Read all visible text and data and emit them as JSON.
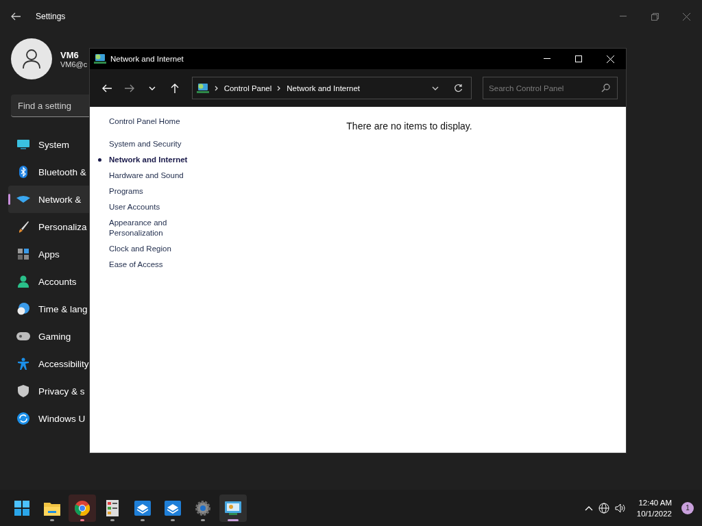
{
  "settings": {
    "title": "Settings",
    "profile": {
      "name": "VM6",
      "email": "VM6@c"
    },
    "search": {
      "placeholder": "Find a setting"
    },
    "nav": [
      {
        "label": "System",
        "selected": false
      },
      {
        "label": "Bluetooth &",
        "selected": false
      },
      {
        "label": "Network &",
        "selected": true
      },
      {
        "label": "Personaliza",
        "selected": false
      },
      {
        "label": "Apps",
        "selected": false
      },
      {
        "label": "Accounts",
        "selected": false
      },
      {
        "label": "Time & lang",
        "selected": false
      },
      {
        "label": "Gaming",
        "selected": false
      },
      {
        "label": "Accessibility",
        "selected": false
      },
      {
        "label": "Privacy & s",
        "selected": false
      },
      {
        "label": "Windows U",
        "selected": false
      }
    ]
  },
  "control_panel": {
    "title": "Network and Internet",
    "address": [
      "Control Panel",
      "Network and Internet"
    ],
    "search": {
      "placeholder": "Search Control Panel"
    },
    "home_link": "Control Panel Home",
    "categories": [
      {
        "label": "System and Security",
        "selected": false
      },
      {
        "label": "Network and Internet",
        "selected": true
      },
      {
        "label": "Hardware and Sound",
        "selected": false
      },
      {
        "label": "Programs",
        "selected": false
      },
      {
        "label": "User Accounts",
        "selected": false
      },
      {
        "label": "Appearance and Personalization",
        "selected": false
      },
      {
        "label": "Clock and Region",
        "selected": false
      },
      {
        "label": "Ease of Access",
        "selected": false
      }
    ],
    "message": "There are no items to display."
  },
  "taskbar": {
    "apps": [
      {
        "running": false,
        "attention": false,
        "focused": false
      },
      {
        "running": true,
        "attention": false,
        "focused": false
      },
      {
        "running": true,
        "attention": true,
        "focused": false
      },
      {
        "running": true,
        "attention": false,
        "focused": false
      },
      {
        "running": true,
        "attention": false,
        "focused": false
      },
      {
        "running": true,
        "attention": false,
        "focused": false
      },
      {
        "running": true,
        "attention": false,
        "focused": false
      },
      {
        "running": true,
        "attention": false,
        "focused": true
      }
    ],
    "clock": {
      "time": "12:40 AM",
      "date": "10/1/2022"
    },
    "notifications": "1"
  }
}
